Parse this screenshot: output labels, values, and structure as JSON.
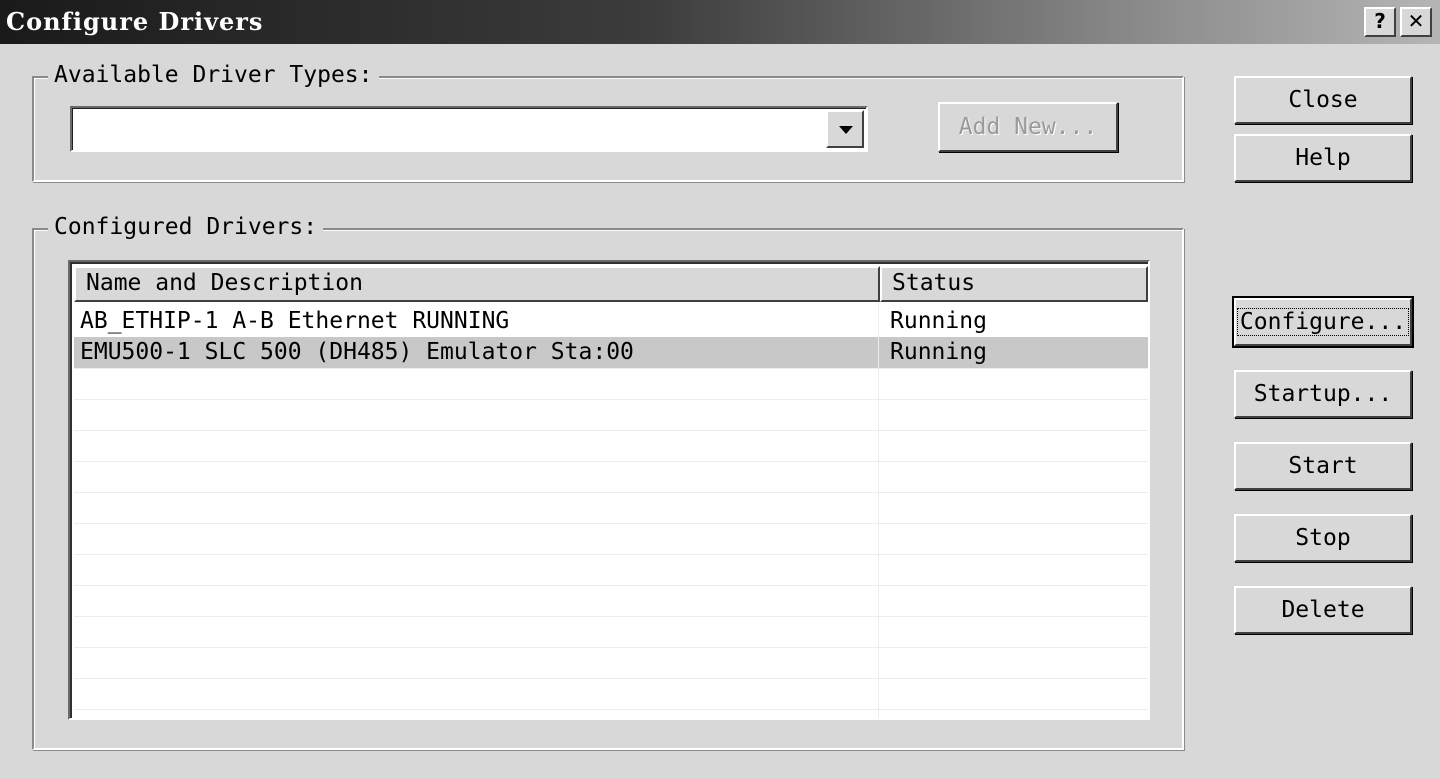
{
  "window": {
    "title": "Configure Drivers",
    "help_glyph": "?",
    "close_glyph": "✕"
  },
  "available": {
    "legend": "Available Driver Types:",
    "selected_value": "",
    "add_new_label": "Add New..."
  },
  "configured": {
    "legend": "Configured Drivers:",
    "columns": [
      "Name and Description",
      "Status"
    ],
    "rows": [
      {
        "name": "AB_ETHIP-1  A-B Ethernet  RUNNING",
        "status": "Running"
      },
      {
        "name": "EMU500-1 SLC 500 (DH485) Emulator Sta:00",
        "status": "Running"
      }
    ]
  },
  "buttons": {
    "close": "Close",
    "help": "Help",
    "configure": "Configure...",
    "startup": "Startup...",
    "start": "Start",
    "stop": "Stop",
    "delete": "Delete"
  },
  "colors": {
    "face": "#d8d8d8",
    "window_bg": "#ffffff",
    "selection": "#c8c8c8"
  }
}
